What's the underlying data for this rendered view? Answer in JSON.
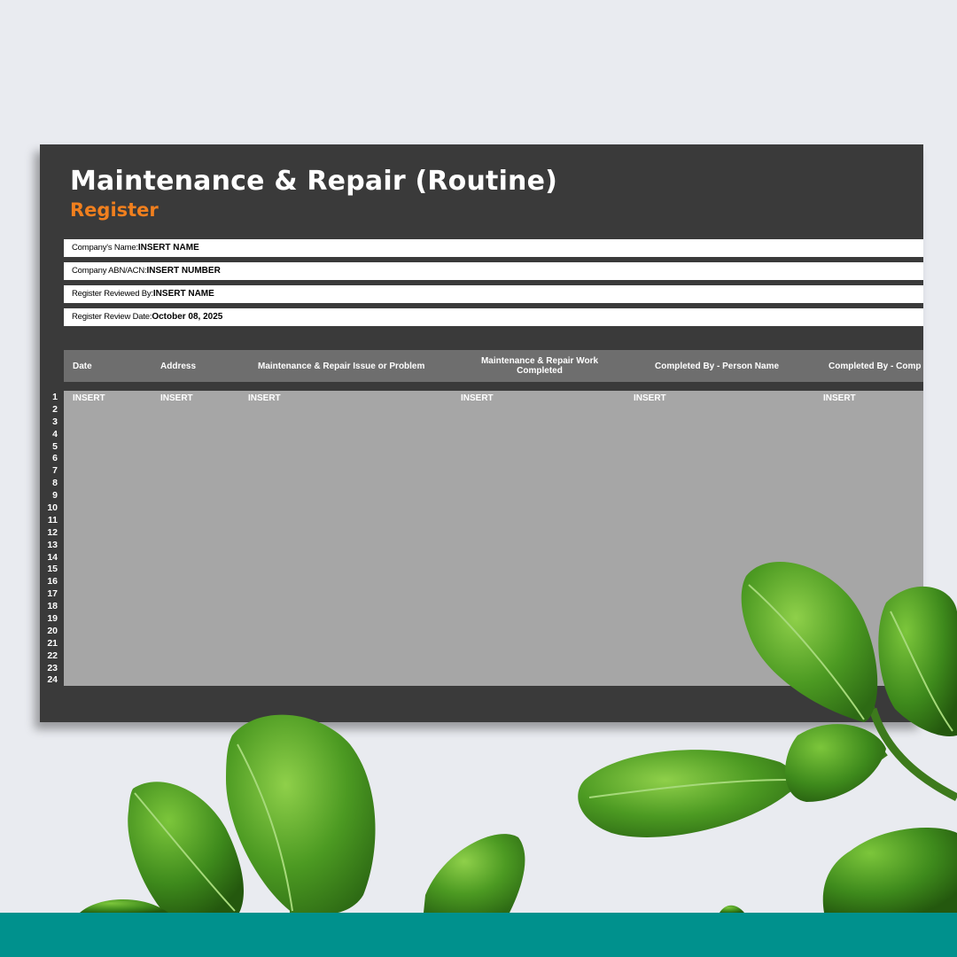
{
  "sheet": {
    "title": "Maintenance & Repair (Routine)",
    "subtitle": "Register",
    "info_rows": [
      {
        "label": "Company's Name:",
        "value": "INSERT NAME"
      },
      {
        "label": "Company ABN/ACN:",
        "value": "INSERT NUMBER"
      },
      {
        "label": "Register Reviewed By:",
        "value": "INSERT NAME"
      },
      {
        "label": "Register Review Date:",
        "value": "October 08, 2025"
      }
    ],
    "columns": [
      "Date",
      "Address",
      "Maintenance & Repair Issue or Problem",
      "Maintenance & Repair Work Completed",
      "Completed By - Person Name",
      "Completed By - Comp"
    ],
    "first_row": [
      "INSERT",
      "INSERT",
      "INSERT",
      "INSERT",
      "INSERT",
      "INSERT"
    ],
    "row_numbers": [
      "1",
      "2",
      "3",
      "4",
      "5",
      "6",
      "7",
      "8",
      "9",
      "10",
      "11",
      "12",
      "13",
      "14",
      "15",
      "16",
      "17",
      "18",
      "19",
      "20",
      "21",
      "22",
      "23",
      "24"
    ]
  },
  "colors": {
    "background": "#e9ebf0",
    "sheet": "#3a3a3a",
    "accent": "#f07f1e",
    "header": "#6e6e6e",
    "body": "#a6a6a6",
    "footer_bar": "#00918d"
  }
}
